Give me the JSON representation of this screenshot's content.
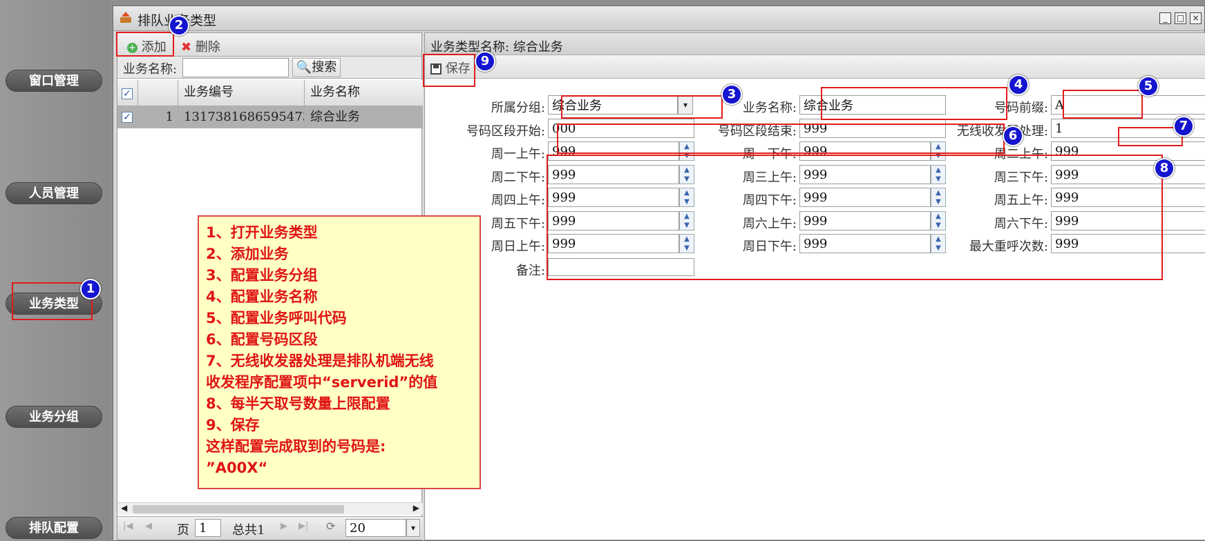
{
  "nav": {
    "items": [
      "窗口管理",
      "人员管理",
      "业务类型",
      "业务分组",
      "排队配置"
    ]
  },
  "window": {
    "title": "排队业务类型",
    "controls": [
      "_",
      "□",
      "×"
    ]
  },
  "left_panel": {
    "toolbar": {
      "add_label": "添加",
      "delete_label": "删除"
    },
    "search": {
      "label": "业务名称:",
      "value": "",
      "button_label": "搜索"
    },
    "grid": {
      "columns": [
        "业务编号",
        "业务名称"
      ],
      "rows": [
        {
          "index": "1",
          "code": "1317381686595473...",
          "name": "综合业务"
        }
      ]
    },
    "pager": {
      "page_label": "页",
      "page_value": "1",
      "total_label": "总共1",
      "page_size": "20"
    }
  },
  "right_panel": {
    "header": "业务类型名称: 综合业务",
    "save_label": "保存",
    "fields": {
      "group_label": "所属分组:",
      "group_value": "综合业务",
      "name_label": "业务名称:",
      "name_value": "综合业务",
      "prefix_label": "号码前缀:",
      "prefix_value": "A",
      "start_label": "号码区段开始:",
      "start_value": "000",
      "end_label": "号码区段结束:",
      "end_value": "999",
      "wireless_label": "无线收发器处理:",
      "wireless_value": "1",
      "mon_am_label": "周一上午:",
      "mon_am": "999",
      "mon_pm_label": "周一下午:",
      "mon_pm": "999",
      "tue_am_label": "周二上午:",
      "tue_am": "999",
      "tue_pm_label": "周二下午:",
      "tue_pm": "999",
      "wed_am_label": "周三上午:",
      "wed_am": "999",
      "wed_pm_label": "周三下午:",
      "wed_pm": "999",
      "thu_am_label": "周四上午:",
      "thu_am": "999",
      "thu_pm_label": "周四下午:",
      "thu_pm": "999",
      "fri_am_label": "周五上午:",
      "fri_am": "999",
      "fri_pm_label": "周五下午:",
      "fri_pm": "999",
      "sat_am_label": "周六上午:",
      "sat_am": "999",
      "sat_pm_label": "周六下午:",
      "sat_pm": "999",
      "sun_am_label": "周日上午:",
      "sun_am": "999",
      "sun_pm_label": "周日下午:",
      "sun_pm": "999",
      "max_recall_label": "最大重呼次数:",
      "max_recall": "999",
      "remark_label": "备注:",
      "remark_value": ""
    }
  },
  "annotation": {
    "badges": [
      "1",
      "2",
      "3",
      "4",
      "5",
      "6",
      "7",
      "8",
      "9"
    ],
    "lines": [
      "1、打开业务类型",
      "2、添加业务",
      "3、配置业务分组",
      "4、配置业务名称",
      "5、配置业务呼叫代码",
      "6、配置号码区段",
      "7、无线收发器处理是排队机端无线",
      "收发程序配置项中“serverid”的值",
      "8、每半天取号数量上限配置",
      "9、保存",
      "这样配置完成取到的号码是:",
      "”A00X“"
    ]
  },
  "colors": {
    "annotation_red": "#e21a1a",
    "badge_blue": "#1515cf",
    "note_bg": "#ffffc6"
  }
}
